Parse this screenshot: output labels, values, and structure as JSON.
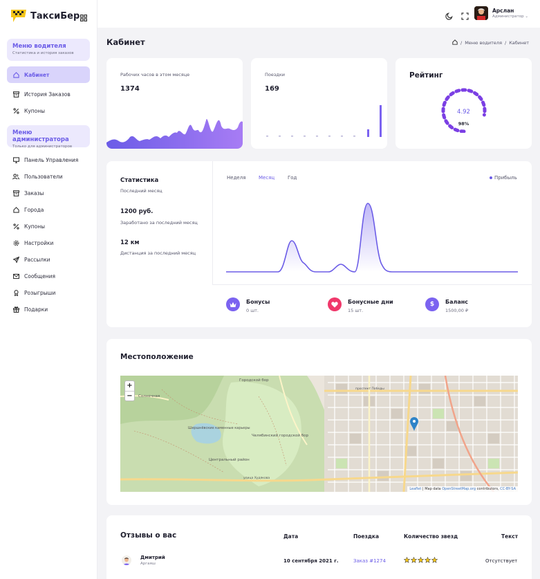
{
  "app": {
    "brand": "ТаксиБер"
  },
  "sidebar": {
    "driver_menu": {
      "title": "Меню водителя",
      "subtitle": "Статистика и история заказов"
    },
    "driver_items": [
      {
        "label": "Кабинет",
        "icon": "home-icon"
      },
      {
        "label": "История Заказов",
        "icon": "archive-icon"
      },
      {
        "label": "Купоны",
        "icon": "percent-icon"
      }
    ],
    "admin_menu": {
      "title": "Меню администратора",
      "subtitle": "Только для администраторов"
    },
    "admin_items": [
      {
        "label": "Панель Управления",
        "icon": "monitor-icon"
      },
      {
        "label": "Пользователи",
        "icon": "users-icon"
      },
      {
        "label": "Заказы",
        "icon": "box-icon"
      },
      {
        "label": "Города",
        "icon": "home-icon"
      },
      {
        "label": "Купоны",
        "icon": "percent-icon"
      },
      {
        "label": "Настройки",
        "icon": "gear-icon"
      },
      {
        "label": "Рассылки",
        "icon": "send-icon"
      },
      {
        "label": "Сообщения",
        "icon": "mail-icon"
      },
      {
        "label": "Розыгрыши",
        "icon": "award-icon"
      },
      {
        "label": "Подарки",
        "icon": "gift-icon"
      }
    ]
  },
  "user": {
    "name": "Арслан",
    "role": "Администратор ⌄"
  },
  "page": {
    "title": "Кабинет"
  },
  "breadcrumb": {
    "parent": "Меню водителя",
    "current": "Кабинет"
  },
  "cards": {
    "hours": {
      "label": "Рабочих часов в этом месяце",
      "value": "1374"
    },
    "trips": {
      "label": "Поездки",
      "value": "169"
    },
    "rating": {
      "title": "Рейтинг",
      "value": "4.92",
      "percent": "98%",
      "percent_value": 98
    }
  },
  "stats": {
    "title": "Статистика",
    "period": "Последний месяц",
    "earned_value": "1200 руб.",
    "earned_label": "Заработано за последний месяц",
    "distance_value": "12 км",
    "distance_label": "Дистанция за последний месяц",
    "tabs": [
      "Неделя",
      "Месяц",
      "Год"
    ],
    "active_tab": "Месяц",
    "legend": "Прибыль"
  },
  "features": [
    {
      "title": "Бонусы",
      "sub": "0 шт.",
      "color": "#7b63f0",
      "icon": "crown-icon"
    },
    {
      "title": "Бонусные дни",
      "sub": "15 шт.",
      "color": "#f0386b",
      "icon": "heart-icon"
    },
    {
      "title": "Баланс",
      "sub": "1500,00 ₽",
      "color": "#7b63f0",
      "icon": "dollar-icon"
    }
  ],
  "location": {
    "title": "Местоположение",
    "zoom_in": "+",
    "zoom_out": "−",
    "attribution": {
      "leaflet": "Leaflet",
      "middle": " | Map data ",
      "osm": "OpenStreetMap.org",
      "contrib": " contributors, ",
      "license": "CC-BY-SA"
    },
    "labels": {
      "bor": "Городской бор",
      "sadovy": "Садовый",
      "solnechny": "Солнечная",
      "kareri": "Шершнёвские каменные карьеры",
      "chel_bor": "Челябинский городской бор",
      "central": "Центральный район",
      "pobedy": "проспект Победы",
      "kudrin": "улица Худякова"
    }
  },
  "reviews": {
    "title": "Отзывы о вас",
    "headers": {
      "date": "Дата",
      "trip": "Поездка",
      "stars": "Количество звезд",
      "text": "Текст"
    },
    "rows": [
      {
        "name": "Дмитрий",
        "city": "Аргаяш",
        "date": "10 сентября 2021 г.",
        "trip": "Заказ #1274",
        "stars": 5,
        "text": "Отсутствует"
      }
    ]
  },
  "colors": {
    "accent": "#6b5ce7",
    "pink": "#f0386b",
    "map_pin": "#2f84c8"
  }
}
